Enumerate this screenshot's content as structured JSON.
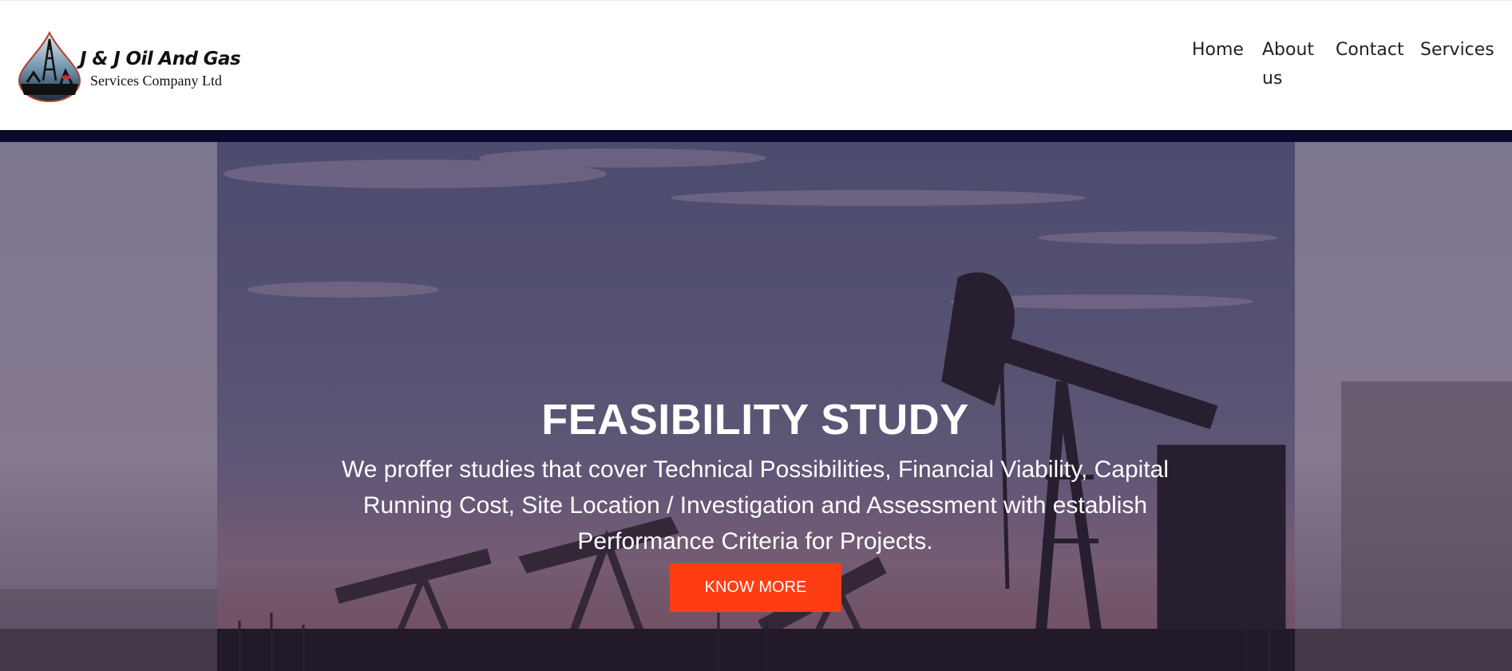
{
  "brand": {
    "title": "J & J Oil And Gas",
    "subtitle": "Services Company Ltd",
    "logo_icon": "oil-derrick-drop-logo"
  },
  "nav": {
    "items": [
      {
        "label": "Home"
      },
      {
        "label": "About us"
      },
      {
        "label": "Contact"
      },
      {
        "label": "Services"
      }
    ]
  },
  "hero": {
    "title": "FEASIBILITY STUDY",
    "text": "We proffer studies that cover Technical Possibilities, Financial Viability, Capital Running Cost, Site Location / Investigation and Assessment with establish Performance Criteria for Projects.",
    "button_label": "KNOW MORE",
    "background_image": "oil-pumpjacks-at-dusk"
  },
  "colors": {
    "header_bar": "#0b0a2e",
    "button": "#ff3d12",
    "text_on_hero": "#ffffff"
  }
}
